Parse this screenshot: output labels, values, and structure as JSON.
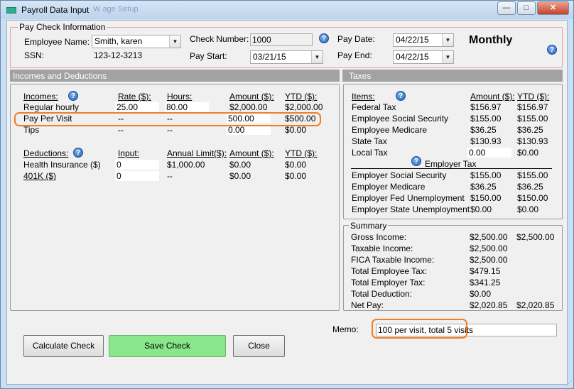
{
  "window": {
    "title": "Payroll Data Input",
    "ghost_title": "W age Setup",
    "minimize": "—",
    "maximize": "□",
    "close": "✕"
  },
  "paycheck": {
    "group_label": "Pay Check Information",
    "employee_name_label": "Employee Name:",
    "employee_name": "Smith, karen",
    "ssn_label": "SSN:",
    "ssn": "123-12-3213",
    "check_number_label": "Check Number:",
    "check_number": "1000",
    "pay_start_label": "Pay Start:",
    "pay_start": "03/21/15",
    "pay_date_label": "Pay Date:",
    "pay_date": "04/22/15",
    "pay_end_label": "Pay End:",
    "pay_end": "04/22/15",
    "frequency": "Monthly"
  },
  "income_section": {
    "header": "Incomes and Deductions",
    "incomes_label": "Incomes:",
    "col_rate": "Rate ($):",
    "col_hours": "Hours:",
    "col_amount": "Amount ($):",
    "col_ytd": "YTD ($):",
    "rows": [
      {
        "name": "Regular hourly",
        "rate": "25.00",
        "hours": "80.00",
        "amount": "$2,000.00",
        "ytd": "$2,000.00"
      },
      {
        "name": "Pay Per Visit",
        "rate": "--",
        "hours": "--",
        "amount": "500.00",
        "ytd": "$500.00"
      },
      {
        "name": "Tips",
        "rate": "--",
        "hours": "--",
        "amount": "0.00",
        "ytd": "$0.00"
      }
    ],
    "deductions_label": "Deductions:",
    "col_input": "Input:",
    "col_limit": "Annual Limit($):",
    "col_damount": "Amount ($):",
    "col_dytd": "YTD ($):",
    "deductions": [
      {
        "name": "Health Insurance  ($)",
        "input": "0",
        "limit": "$1,000.00",
        "amount": "$0.00",
        "ytd": "$0.00"
      },
      {
        "name": "401K  ($)",
        "input": "0",
        "limit": "--",
        "amount": "$0.00",
        "ytd": "$0.00"
      }
    ]
  },
  "taxes": {
    "header": "Taxes",
    "items_label": "Items:",
    "col_amount": "Amount ($):",
    "col_ytd": "YTD ($):",
    "employee_rows": [
      {
        "name": "Federal Tax",
        "amount": "$156.97",
        "ytd": "$156.97"
      },
      {
        "name": "Employee Social Security",
        "amount": "$155.00",
        "ytd": "$155.00"
      },
      {
        "name": "Employee Medicare",
        "amount": "$36.25",
        "ytd": "$36.25"
      },
      {
        "name": "State Tax",
        "amount": "$130.93",
        "ytd": "$130.93"
      },
      {
        "name": "Local Tax",
        "amount": "0.00",
        "ytd": "$0.00"
      }
    ],
    "employer_header": "Employer Tax",
    "employer_rows": [
      {
        "name": "Employer Social Security",
        "amount": "$155.00",
        "ytd": "$155.00"
      },
      {
        "name": "Employer Medicare",
        "amount": "$36.25",
        "ytd": "$36.25"
      },
      {
        "name": "Employer Fed Unemployment",
        "amount": "$150.00",
        "ytd": "$150.00"
      },
      {
        "name": "Employer State Unemployment",
        "amount": "$0.00",
        "ytd": "$0.00"
      }
    ]
  },
  "summary": {
    "label": "Summary",
    "rows": [
      {
        "name": "Gross Income:",
        "amount": "$2,500.00",
        "ytd": "$2,500.00"
      },
      {
        "name": "Taxable Income:",
        "amount": "$2,500.00",
        "ytd": ""
      },
      {
        "name": "FICA Taxable Income:",
        "amount": "$2,500.00",
        "ytd": ""
      },
      {
        "name": "Total Employee Tax:",
        "amount": "$479.15",
        "ytd": ""
      },
      {
        "name": "Total Employer Tax:",
        "amount": "$341.25",
        "ytd": ""
      },
      {
        "name": "Total Deduction:",
        "amount": "$0.00",
        "ytd": ""
      },
      {
        "name": "Net Pay:",
        "amount": "$2,020.85",
        "ytd": "$2,020.85"
      }
    ]
  },
  "memo": {
    "label": "Memo:",
    "value": "100 per visit, total 5 visits"
  },
  "buttons": {
    "calculate": "Calculate Check",
    "save": "Save Check",
    "close": "Close"
  },
  "colors": {
    "highlight": "#f07e26",
    "save_button": "#8ae68a",
    "section_header_bar": "#a2a2a2"
  }
}
